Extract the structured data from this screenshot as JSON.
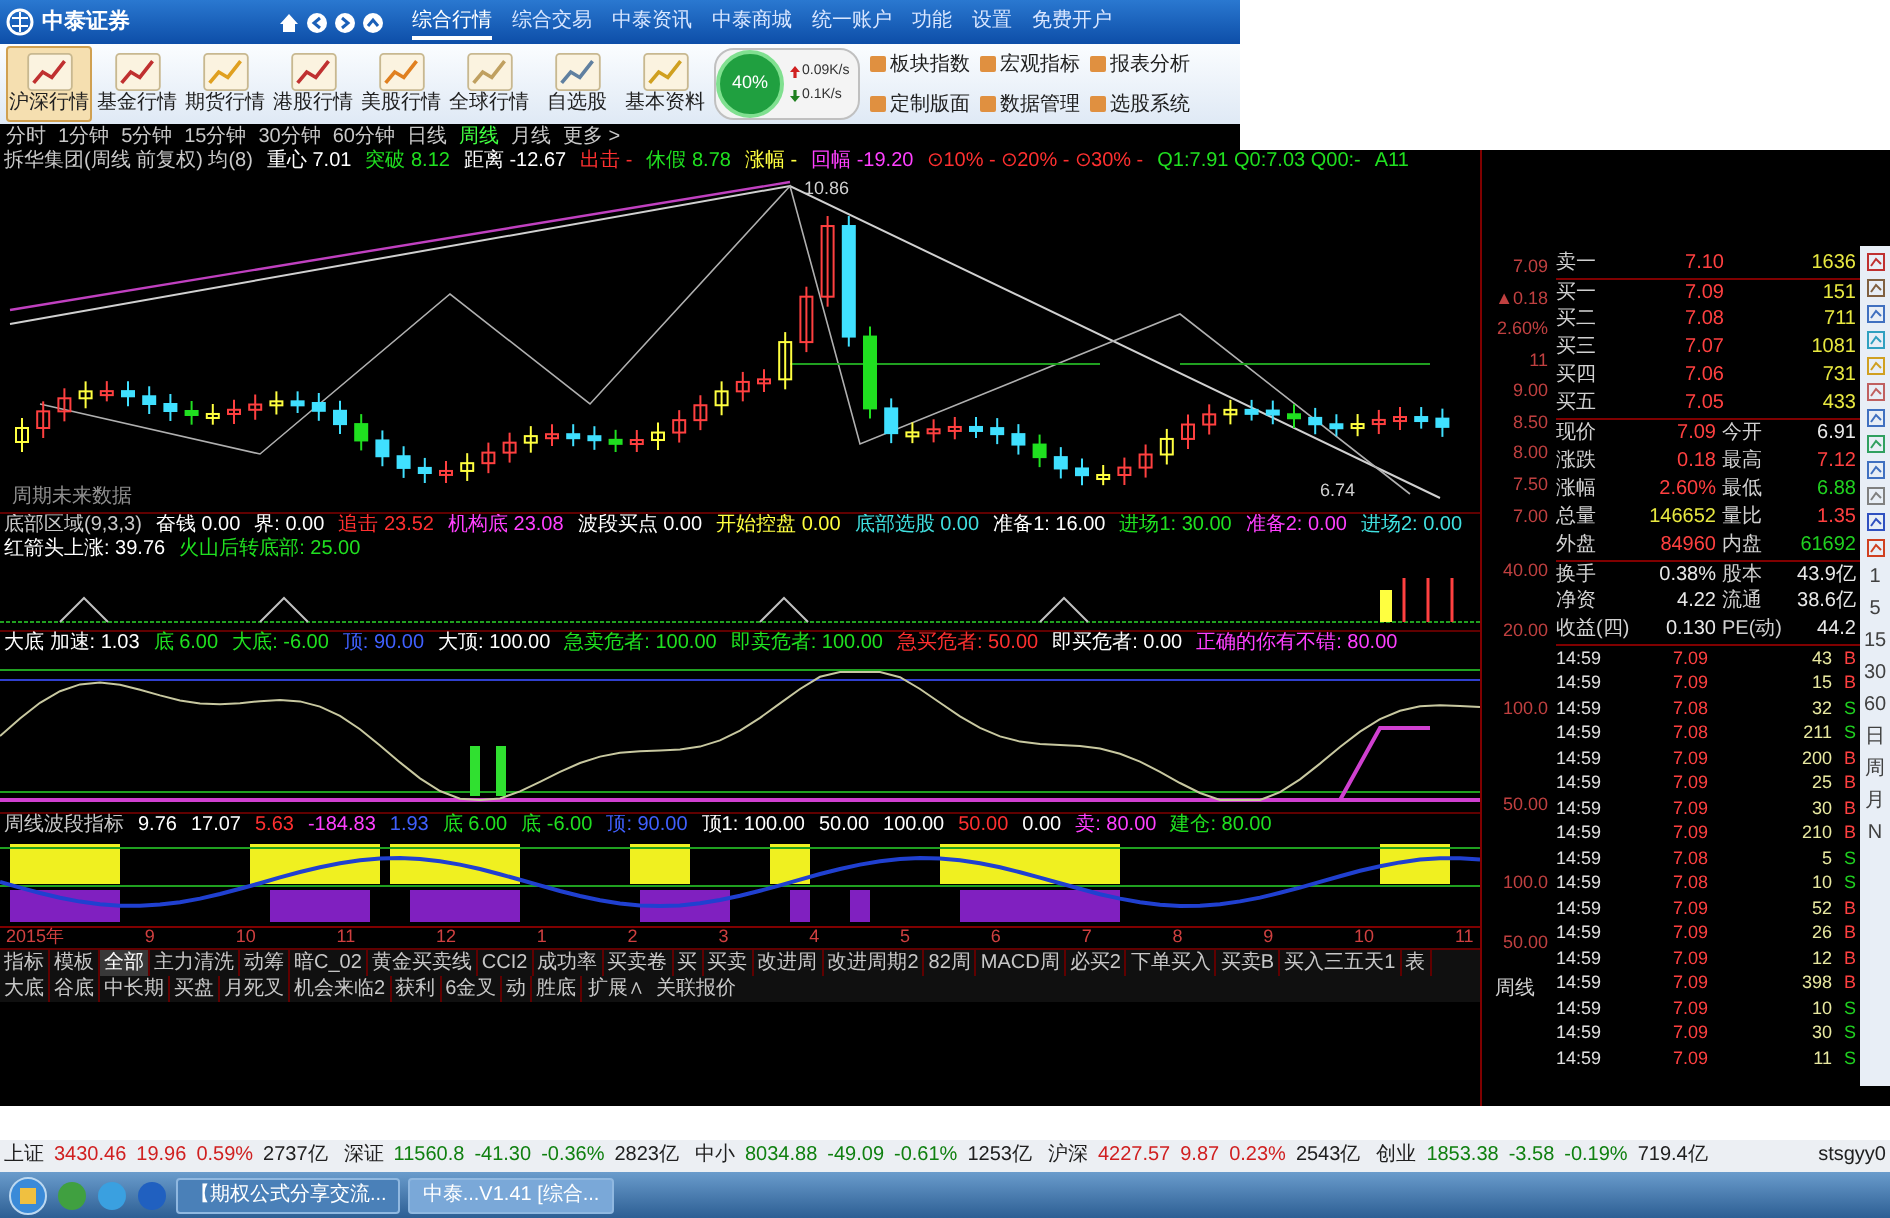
{
  "app": {
    "logo": "中泰证券"
  },
  "nav": [
    {
      "label": "综合行情",
      "selected": true
    },
    {
      "label": "综合交易",
      "selected": false
    },
    {
      "label": "中泰资讯",
      "selected": false
    },
    {
      "label": "中泰商城",
      "selected": false
    },
    {
      "label": "统一账户",
      "selected": false
    },
    {
      "label": "功能",
      "selected": false
    },
    {
      "label": "设置",
      "selected": false
    },
    {
      "label": "免费开户",
      "selected": false
    }
  ],
  "toolbar": [
    {
      "label": "沪深行情",
      "selected": true
    },
    {
      "label": "基金行情",
      "selected": false
    },
    {
      "label": "期货行情",
      "selected": false
    },
    {
      "label": "港股行情",
      "selected": false
    },
    {
      "label": "美股行情",
      "selected": false
    },
    {
      "label": "全球行情",
      "selected": false
    },
    {
      "label": "自选股",
      "selected": false
    },
    {
      "label": "基本资料",
      "selected": false
    }
  ],
  "net_widget": {
    "percent": "40%",
    "upload": "0.09K/s",
    "download": "0.1K/s"
  },
  "tool_links": [
    {
      "label": "板块指数"
    },
    {
      "label": "宏观指标"
    },
    {
      "label": "报表分析"
    },
    {
      "label": "定制版面"
    },
    {
      "label": "数据管理"
    },
    {
      "label": "选股系统"
    }
  ],
  "periods": [
    {
      "label": "分时",
      "selected": false
    },
    {
      "label": "1分钟",
      "selected": false
    },
    {
      "label": "5分钟",
      "selected": false
    },
    {
      "label": "15分钟",
      "selected": false
    },
    {
      "label": "30分钟",
      "selected": false
    },
    {
      "label": "60分钟",
      "selected": false
    },
    {
      "label": "日线",
      "selected": false
    },
    {
      "label": "周线",
      "selected": true
    },
    {
      "label": "月线",
      "selected": false
    },
    {
      "label": "更多 >",
      "selected": false
    }
  ],
  "price_chart": {
    "legend": [
      {
        "text": "拆华集团(周线 前复权) 均(8)",
        "color": "#c8c8c8"
      },
      {
        "text": "重心 7.01",
        "color": "#ffffff"
      },
      {
        "text": "突破 8.12",
        "color": "#20e020"
      },
      {
        "text": "距离 -12.67",
        "color": "#ffffff"
      },
      {
        "text": "出击 -",
        "color": "#ff3030"
      },
      {
        "text": "休假 8.78",
        "color": "#20e020"
      },
      {
        "text": "涨幅 -",
        "color": "#ffff40"
      },
      {
        "text": "回幅 -19.20",
        "color": "#ff40ff"
      },
      {
        "text": "⊙10% - ⊙20% - ⊙30% -",
        "color": "#ff3030"
      },
      {
        "text": "Q1:7.91 Q0:7.03 Q00:-",
        "color": "#20e020"
      },
      {
        "text": "A11",
        "color": "#20e020"
      }
    ],
    "labels": [
      "10.86",
      "6.74",
      "周期未来数据"
    ],
    "axis": [
      "7.09",
      "▲0.18",
      "2.60%",
      "11",
      "9.00",
      "8.50",
      "8.00",
      "7.50",
      "7.00"
    ]
  },
  "indicator_1": {
    "legend": [
      {
        "text": "底部区域(9,3,3)",
        "color": "#c8c8c8"
      },
      {
        "text": "奋钱 0.00",
        "color": "#ffffff"
      },
      {
        "text": "界: 0.00",
        "color": "#ffffff"
      },
      {
        "text": "追击 23.52",
        "color": "#ff3030"
      },
      {
        "text": "机构底 23.08",
        "color": "#ff40ff"
      },
      {
        "text": "波段买点 0.00",
        "color": "#ffffff"
      },
      {
        "text": "开始控盘 0.00",
        "color": "#ffff40"
      },
      {
        "text": "底部选股 0.00",
        "color": "#40e0e0"
      },
      {
        "text": "准备1: 16.00",
        "color": "#ffffff"
      },
      {
        "text": "进场1: 30.00",
        "color": "#20e020"
      },
      {
        "text": "准备2: 0.00",
        "color": "#ff40ff"
      },
      {
        "text": "进场2: 0.00",
        "color": "#40e0e0"
      },
      {
        "text": "红箭头上涨: 39.76",
        "color": "#ffffff"
      },
      {
        "text": "火山后转底部: 25.00",
        "color": "#20e020"
      }
    ],
    "axis": [
      "40.00",
      "20.00"
    ]
  },
  "indicator_2": {
    "legend": [
      {
        "text": "大底 加速: 1.03",
        "color": "#ffffff"
      },
      {
        "text": "底 6.00",
        "color": "#20e020"
      },
      {
        "text": "大底: -6.00",
        "color": "#20e020"
      },
      {
        "text": "顶: 90.00",
        "color": "#4060ff"
      },
      {
        "text": "大顶: 100.00",
        "color": "#ffffff"
      },
      {
        "text": "急卖危者: 100.00",
        "color": "#20e020"
      },
      {
        "text": "即卖危者: 100.00",
        "color": "#20e020"
      },
      {
        "text": "急买危者: 50.00",
        "color": "#ff3030"
      },
      {
        "text": "即买危者: 0.00",
        "color": "#ffffff"
      },
      {
        "text": "正确的你有不错: 80.00",
        "color": "#ff40ff"
      }
    ],
    "axis": [
      "100.0",
      "50.00"
    ]
  },
  "indicator_3": {
    "legend": [
      {
        "text": "周线波段指标",
        "color": "#c8c8c8"
      },
      {
        "text": "9.76",
        "color": "#ffffff"
      },
      {
        "text": "17.07",
        "color": "#ffffff"
      },
      {
        "text": "5.63",
        "color": "#ff3030"
      },
      {
        "text": "-184.83",
        "color": "#ff40ff"
      },
      {
        "text": "1.93",
        "color": "#4060ff"
      },
      {
        "text": "底 6.00",
        "color": "#20e020"
      },
      {
        "text": "底 -6.00",
        "color": "#20e020"
      },
      {
        "text": "顶: 90.00",
        "color": "#4060ff"
      },
      {
        "text": "顶1: 100.00",
        "color": "#ffffff"
      },
      {
        "text": "50.00",
        "color": "#ffffff"
      },
      {
        "text": "100.00",
        "color": "#ffffff"
      },
      {
        "text": "50.00",
        "color": "#ff3030"
      },
      {
        "text": "0.00",
        "color": "#ffffff"
      },
      {
        "text": "卖: 80.00",
        "color": "#ff40ff"
      },
      {
        "text": "建仓: 80.00",
        "color": "#20e020"
      }
    ],
    "axis": [
      "100.0",
      "50.00"
    ]
  },
  "x_axis": [
    "2015年",
    "9",
    "10",
    "11",
    "12",
    "1",
    "2",
    "3",
    "4",
    "5",
    "6",
    "7",
    "8",
    "9",
    "10",
    "11"
  ],
  "period_label": "周线",
  "formula_tabs": [
    {
      "label": "指标",
      "selected": false
    },
    {
      "label": "模板",
      "selected": false
    },
    {
      "label": "全部",
      "selected": true
    },
    {
      "label": "主力清洗",
      "selected": false
    },
    {
      "label": "动筹",
      "selected": false
    },
    {
      "label": "暗C_02",
      "selected": false
    },
    {
      "label": "黄金买卖线",
      "selected": false
    },
    {
      "label": "CCI2",
      "selected": false
    },
    {
      "label": "成功率",
      "selected": false
    },
    {
      "label": "买卖卷",
      "selected": false
    },
    {
      "label": "买",
      "selected": false
    },
    {
      "label": "买卖",
      "selected": false
    },
    {
      "label": "改进周",
      "selected": false
    },
    {
      "label": "改进周期2",
      "selected": false
    },
    {
      "label": "82周",
      "selected": false
    },
    {
      "label": "MACD周",
      "selected": false
    },
    {
      "label": "必买2",
      "selected": false
    },
    {
      "label": "下单买入",
      "selected": false
    },
    {
      "label": "买卖B",
      "selected": false
    },
    {
      "label": "买入三五天1",
      "selected": false
    },
    {
      "label": "表",
      "selected": false
    },
    {
      "label": "大底",
      "selected": false
    },
    {
      "label": "谷底",
      "selected": false
    },
    {
      "label": "中长期",
      "selected": false
    },
    {
      "label": "买盘",
      "selected": false
    },
    {
      "label": "月死叉",
      "selected": false
    },
    {
      "label": "机会来临2",
      "selected": false
    },
    {
      "label": "获利",
      "selected": false
    },
    {
      "label": "6金叉",
      "selected": false
    },
    {
      "label": "动",
      "selected": false
    },
    {
      "label": "胜底",
      "selected": false
    }
  ],
  "extra_tabs": [
    {
      "label": "扩展∧"
    },
    {
      "label": "关联报价"
    }
  ],
  "order_book": [
    {
      "label": "卖一",
      "price": "7.10",
      "volume": "1636",
      "color": "#ff4040"
    },
    {
      "label": "买一",
      "price": "7.09",
      "volume": "151",
      "color": "#ff4040"
    },
    {
      "label": "买二",
      "price": "7.08",
      "volume": "711",
      "color": "#ff4040"
    },
    {
      "label": "买三",
      "price": "7.07",
      "volume": "1081",
      "color": "#ff4040"
    },
    {
      "label": "买四",
      "price": "7.06",
      "volume": "731",
      "color": "#ff4040"
    },
    {
      "label": "买五",
      "price": "7.05",
      "volume": "433",
      "color": "#ff4040"
    }
  ],
  "stats": [
    {
      "cells": [
        {
          "label": "现价",
          "value": "7.09",
          "color": "#ff4040"
        },
        {
          "label": "今开",
          "value": "6.91",
          "color": "#e8e8e8"
        }
      ]
    },
    {
      "cells": [
        {
          "label": "涨跌",
          "value": "0.18",
          "color": "#ff4040"
        },
        {
          "label": "最高",
          "value": "7.12",
          "color": "#ff4040"
        }
      ]
    },
    {
      "cells": [
        {
          "label": "涨幅",
          "value": "2.60%",
          "color": "#ff4040"
        },
        {
          "label": "最低",
          "value": "6.88",
          "color": "#20d020"
        }
      ]
    },
    {
      "cells": [
        {
          "label": "总量",
          "value": "146652",
          "color": "#e8e840"
        },
        {
          "label": "量比",
          "value": "1.35",
          "color": "#ff4040"
        }
      ]
    },
    {
      "cells": [
        {
          "label": "外盘",
          "value": "84960",
          "color": "#ff4040"
        },
        {
          "label": "内盘",
          "value": "61692",
          "color": "#20d020"
        }
      ]
    },
    {
      "cells": [
        {
          "label": "换手",
          "value": "0.38%",
          "color": "#e8e8e8"
        },
        {
          "label": "股本",
          "value": "43.9亿",
          "color": "#e8e8e8"
        }
      ]
    },
    {
      "cells": [
        {
          "label": "净资",
          "value": "4.22",
          "color": "#e8e8e8"
        },
        {
          "label": "流通",
          "value": "38.6亿",
          "color": "#e8e8e8"
        }
      ]
    },
    {
      "cells": [
        {
          "label": "收益(四)",
          "value": "0.130",
          "color": "#e8e8e8"
        },
        {
          "label": "PE(动)",
          "value": "44.2",
          "color": "#e8e8e8"
        }
      ]
    }
  ],
  "ticks": [
    {
      "time": "14:59",
      "price": "7.09",
      "volume": "43",
      "side": "B",
      "color": "#ff4040"
    },
    {
      "time": "14:59",
      "price": "7.09",
      "volume": "15",
      "side": "B",
      "color": "#ff4040"
    },
    {
      "time": "14:59",
      "price": "7.08",
      "volume": "32",
      "side": "S",
      "color": "#20d020"
    },
    {
      "time": "14:59",
      "price": "7.08",
      "volume": "211",
      "side": "S",
      "color": "#20d020"
    },
    {
      "time": "14:59",
      "price": "7.09",
      "volume": "200",
      "side": "B",
      "color": "#ff4040"
    },
    {
      "time": "14:59",
      "price": "7.09",
      "volume": "25",
      "side": "B",
      "color": "#ff4040"
    },
    {
      "time": "14:59",
      "price": "7.09",
      "volume": "30",
      "side": "B",
      "color": "#ff4040"
    },
    {
      "time": "14:59",
      "price": "7.09",
      "volume": "210",
      "side": "B",
      "color": "#ff4040"
    },
    {
      "time": "14:59",
      "price": "7.08",
      "volume": "5",
      "side": "S",
      "color": "#20d020"
    },
    {
      "time": "14:59",
      "price": "7.08",
      "volume": "10",
      "side": "S",
      "color": "#20d020"
    },
    {
      "time": "14:59",
      "price": "7.09",
      "volume": "52",
      "side": "B",
      "color": "#ff4040"
    },
    {
      "time": "14:59",
      "price": "7.09",
      "volume": "26",
      "side": "B",
      "color": "#ff4040"
    },
    {
      "time": "14:59",
      "price": "7.09",
      "volume": "12",
      "side": "B",
      "color": "#ff4040"
    },
    {
      "time": "14:59",
      "price": "7.09",
      "volume": "398",
      "side": "B",
      "color": "#ff4040"
    },
    {
      "time": "14:59",
      "price": "7.09",
      "volume": "10",
      "side": "S",
      "color": "#20d020"
    },
    {
      "time": "14:59",
      "price": "7.09",
      "volume": "30",
      "side": "S",
      "color": "#20d020"
    },
    {
      "time": "14:59",
      "price": "7.09",
      "volume": "11",
      "side": "S",
      "color": "#20d020"
    }
  ],
  "side_toolbar": {
    "periods": [
      "1",
      "5",
      "15",
      "30",
      "60",
      "日",
      "周",
      "月",
      "N"
    ]
  },
  "ticker": [
    {
      "name": "上证",
      "value": "3430.46",
      "change": "19.96",
      "pct": "0.59%",
      "amount": "2737亿",
      "color": "#d02020"
    },
    {
      "name": "深证",
      "value": "11560.8",
      "change": "-41.30",
      "pct": "-0.36%",
      "amount": "2823亿",
      "color": "#108010"
    },
    {
      "name": "中小",
      "value": "8034.88",
      "change": "-49.09",
      "pct": "-0.61%",
      "amount": "1253亿",
      "color": "#108010"
    },
    {
      "name": "沪深",
      "value": "4227.57",
      "change": "9.87",
      "pct": "0.23%",
      "amount": "2543亿",
      "color": "#d02020"
    },
    {
      "name": "创业",
      "value": "1853.38",
      "change": "-3.58",
      "pct": "-0.19%",
      "amount": "719.4亿",
      "color": "#108010"
    }
  ],
  "ticker_user": "stsgyy0",
  "taskbar": {
    "windows": [
      {
        "title": "【期权公式分享交流...",
        "selected": false
      },
      {
        "title": "中泰...V1.41 [综合...",
        "selected": true
      }
    ]
  }
}
